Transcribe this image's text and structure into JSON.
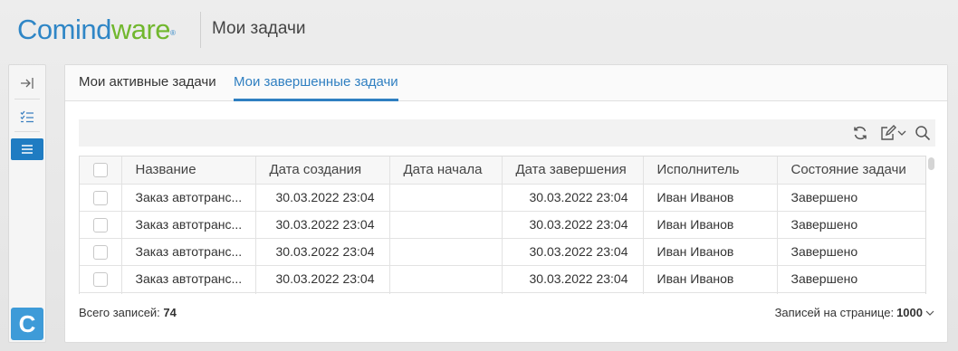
{
  "header": {
    "logo_part1": "Comind",
    "logo_part2": "ware",
    "logo_reg": "®",
    "title": "Мои задачи"
  },
  "sidebar": {
    "badge_letter": "C",
    "icons": [
      "collapse-icon",
      "checklist-icon",
      "list-icon"
    ]
  },
  "tabs": [
    {
      "label": "Мои активные задачи",
      "active": false
    },
    {
      "label": "Мои завершенные задачи",
      "active": true
    }
  ],
  "toolbar": {
    "icons": [
      "refresh-icon",
      "edit-icon",
      "search-icon"
    ]
  },
  "table": {
    "columns": [
      "Название",
      "Дата создания",
      "Дата начала",
      "Дата завершения",
      "Исполнитель",
      "Состояние задачи"
    ],
    "rows": [
      {
        "name": "Заказ автотранс...",
        "created": "30.03.2022 23:04",
        "start": "",
        "end": "30.03.2022 23:04",
        "assignee": "Иван Иванов",
        "status": "Завершено"
      },
      {
        "name": "Заказ автотранс...",
        "created": "30.03.2022 23:04",
        "start": "",
        "end": "30.03.2022 23:04",
        "assignee": "Иван Иванов",
        "status": "Завершено"
      },
      {
        "name": "Заказ автотранс...",
        "created": "30.03.2022 23:04",
        "start": "",
        "end": "30.03.2022 23:04",
        "assignee": "Иван Иванов",
        "status": "Завершено"
      },
      {
        "name": "Заказ автотранс...",
        "created": "30.03.2022 23:04",
        "start": "",
        "end": "30.03.2022 23:04",
        "assignee": "Иван Иванов",
        "status": "Завершено"
      }
    ]
  },
  "footer": {
    "total_label": "Всего записей:",
    "total_value": "74",
    "page_size_label": "Записей на странице:",
    "page_size_value": "1000"
  },
  "colors": {
    "accent": "#2f7fc1",
    "logo_blue": "#2f86c6",
    "logo_green": "#71b72e",
    "badge": "#3e9bd8"
  }
}
